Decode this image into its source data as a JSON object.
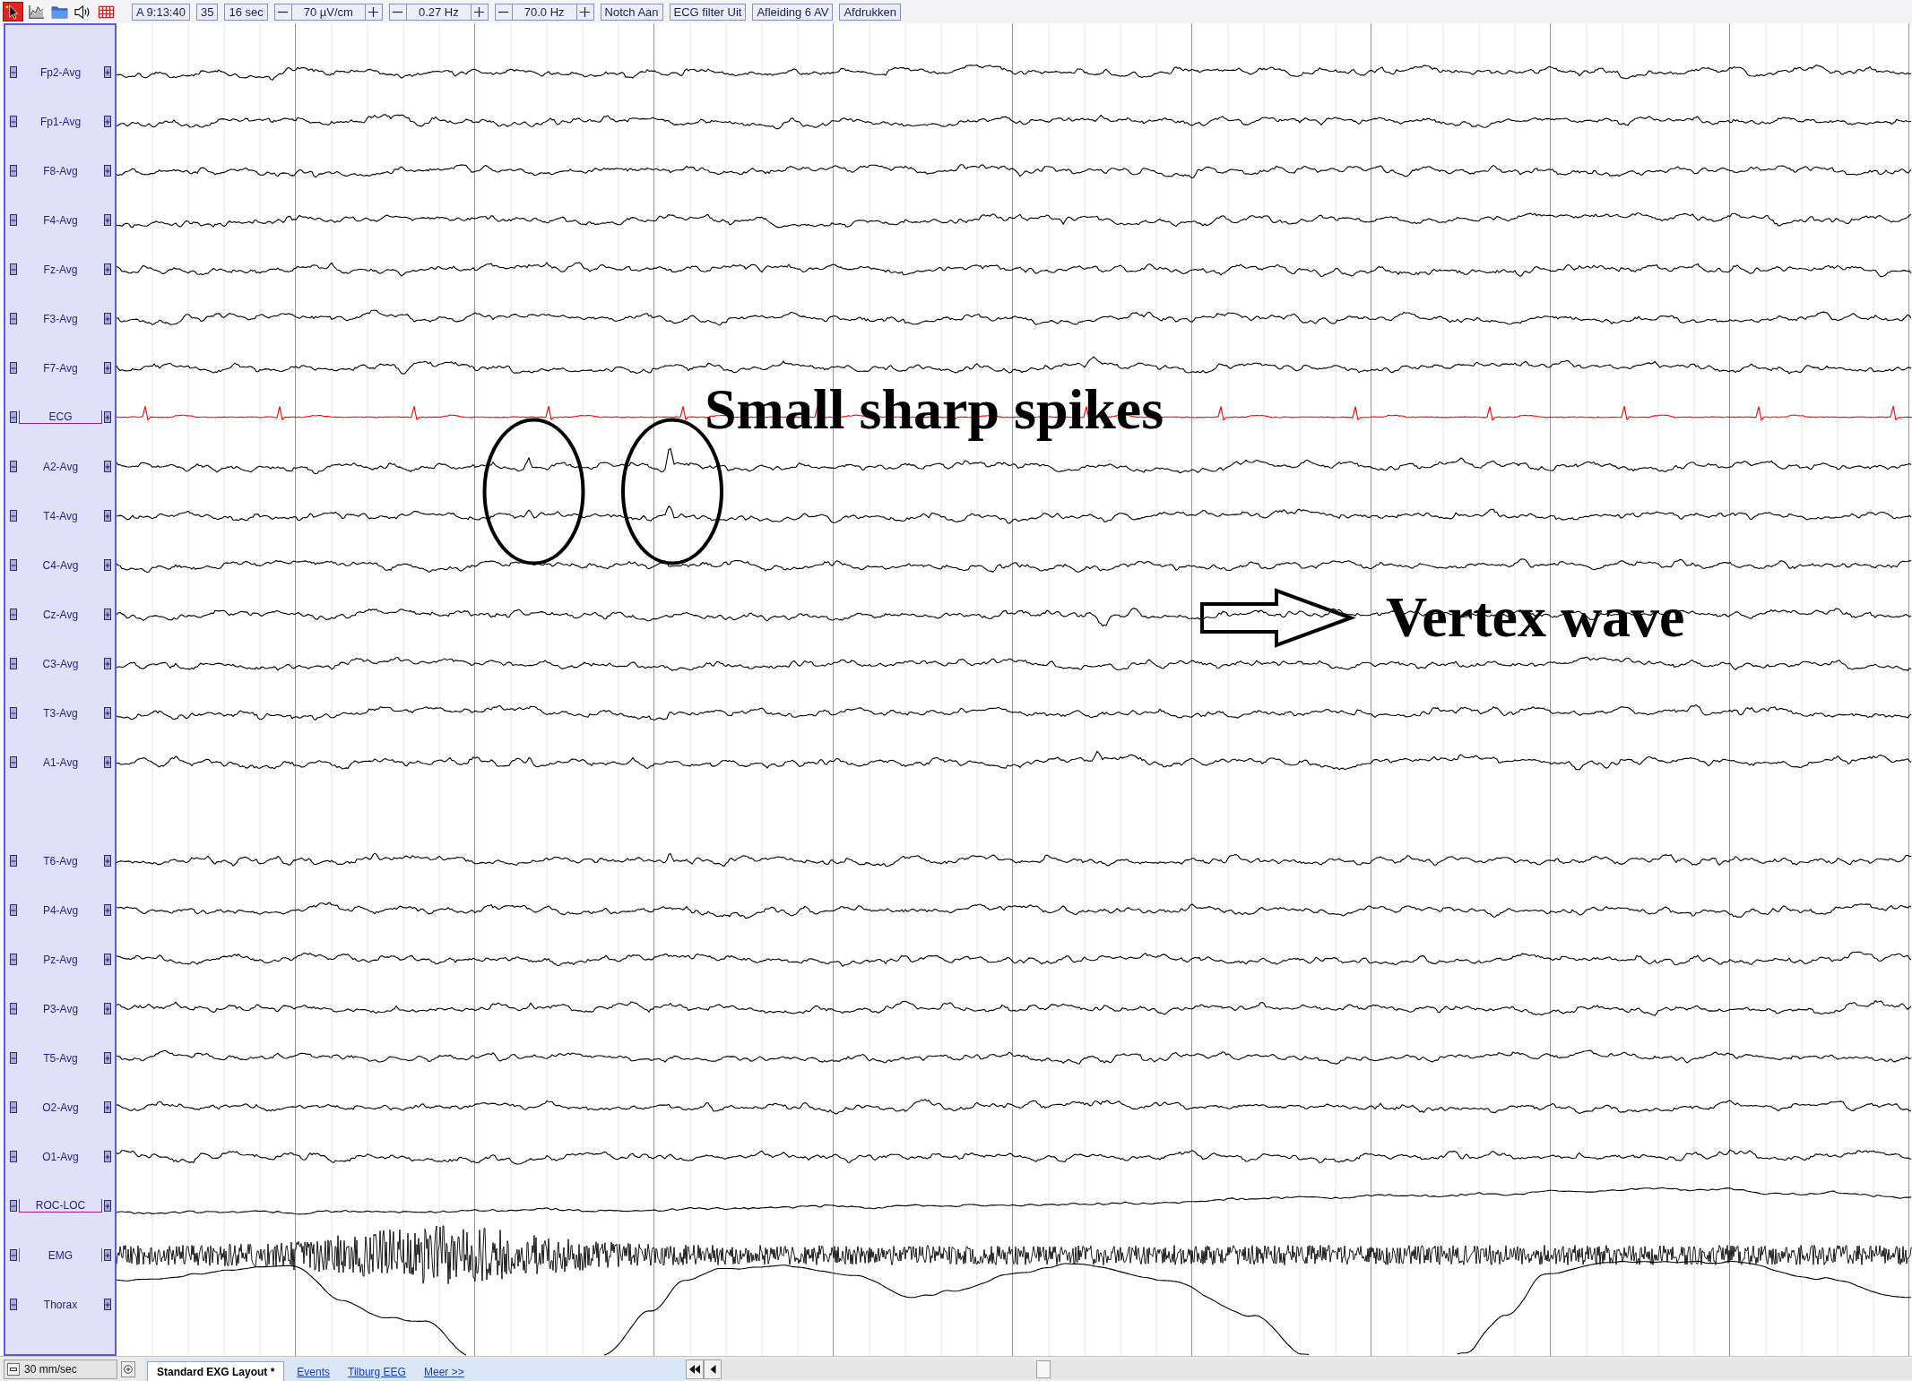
{
  "toolbar": {
    "tools": [
      {
        "kind": "pointer",
        "selected": true
      },
      {
        "kind": "chart",
        "selected": false
      },
      {
        "kind": "folder",
        "selected": false
      },
      {
        "kind": "speaker",
        "selected": false
      },
      {
        "kind": "grid",
        "selected": false
      }
    ],
    "controls": [
      {
        "kind": "button",
        "label": "A 9:13:40"
      },
      {
        "kind": "button",
        "label": "35"
      },
      {
        "kind": "button",
        "label": "16 sec"
      },
      {
        "kind": "stepper",
        "label": "70 µV/cm"
      },
      {
        "kind": "stepper",
        "label": "0.27 Hz"
      },
      {
        "kind": "stepper",
        "label": "70.0 Hz"
      },
      {
        "kind": "button",
        "label": "Notch Aan"
      },
      {
        "kind": "button",
        "label": "ECG filter Uit"
      },
      {
        "kind": "button",
        "label": "Afleiding 6 AV"
      },
      {
        "kind": "button",
        "label": "Afdrukken"
      }
    ]
  },
  "channel_groups": [
    {
      "channels": [
        {
          "name": "Fp2-Avg",
          "kind": "eeg",
          "color": "#000000",
          "underlined": false,
          "side_lines": false
        },
        {
          "name": "Fp1-Avg",
          "kind": "eeg",
          "color": "#000000",
          "underlined": false,
          "side_lines": false
        },
        {
          "name": "F8-Avg",
          "kind": "eeg",
          "color": "#000000",
          "underlined": false,
          "side_lines": false
        },
        {
          "name": "F4-Avg",
          "kind": "eeg",
          "color": "#000000",
          "underlined": false,
          "side_lines": false
        },
        {
          "name": "Fz-Avg",
          "kind": "eeg",
          "color": "#000000",
          "underlined": false,
          "side_lines": false
        },
        {
          "name": "F3-Avg",
          "kind": "eeg",
          "color": "#000000",
          "underlined": false,
          "side_lines": false
        },
        {
          "name": "F7-Avg",
          "kind": "eeg",
          "color": "#000000",
          "underlined": false,
          "side_lines": false
        },
        {
          "name": "ECG",
          "kind": "ecg",
          "color": "#ff0000",
          "underlined": true,
          "side_lines": false
        },
        {
          "name": "A2-Avg",
          "kind": "eeg",
          "color": "#000000",
          "underlined": false,
          "side_lines": false
        },
        {
          "name": "T4-Avg",
          "kind": "eeg",
          "color": "#000000",
          "underlined": false,
          "side_lines": false
        },
        {
          "name": "C4-Avg",
          "kind": "eeg",
          "color": "#000000",
          "underlined": false,
          "side_lines": false
        },
        {
          "name": "Cz-Avg",
          "kind": "eeg",
          "color": "#000000",
          "underlined": false,
          "side_lines": false
        },
        {
          "name": "C3-Avg",
          "kind": "eeg",
          "color": "#000000",
          "underlined": false,
          "side_lines": false
        },
        {
          "name": "T3-Avg",
          "kind": "eeg",
          "color": "#000000",
          "underlined": false,
          "side_lines": false
        },
        {
          "name": "A1-Avg",
          "kind": "eeg",
          "color": "#000000",
          "underlined": false,
          "side_lines": false
        }
      ]
    },
    {
      "channels": [
        {
          "name": "T6-Avg",
          "kind": "eeg",
          "color": "#000000",
          "underlined": false,
          "side_lines": false
        },
        {
          "name": "P4-Avg",
          "kind": "eeg",
          "color": "#000000",
          "underlined": false,
          "side_lines": false
        },
        {
          "name": "Pz-Avg",
          "kind": "eeg",
          "color": "#000000",
          "underlined": false,
          "side_lines": false
        },
        {
          "name": "P3-Avg",
          "kind": "eeg",
          "color": "#000000",
          "underlined": false,
          "side_lines": false
        },
        {
          "name": "T5-Avg",
          "kind": "eeg",
          "color": "#000000",
          "underlined": false,
          "side_lines": false
        },
        {
          "name": "O2-Avg",
          "kind": "eeg",
          "color": "#000000",
          "underlined": false,
          "side_lines": false
        },
        {
          "name": "O1-Avg",
          "kind": "eeg",
          "color": "#000000",
          "underlined": false,
          "side_lines": false
        },
        {
          "name": "ROC-LOC",
          "kind": "eog",
          "color": "#000000",
          "underlined": true,
          "side_lines": false
        },
        {
          "name": "EMG",
          "kind": "emg",
          "color": "#000000",
          "underlined": false,
          "side_lines": true
        },
        {
          "name": "Thorax",
          "kind": "resp",
          "color": "#000000",
          "underlined": false,
          "side_lines": false
        }
      ]
    }
  ],
  "annotations": [
    {
      "kind": "circled",
      "text": "Small sharp spikes"
    },
    {
      "kind": "arrow",
      "text": "Vertex wave"
    }
  ],
  "bottom_bar": {
    "timebase": "30 mm/sec",
    "tabs": [
      {
        "label": "Standard EXG Layout *",
        "selected": true
      },
      {
        "label": "Events",
        "selected": false
      },
      {
        "label": "Tilburg EEG",
        "selected": false
      },
      {
        "label": "Meer >>",
        "selected": false
      }
    ]
  }
}
